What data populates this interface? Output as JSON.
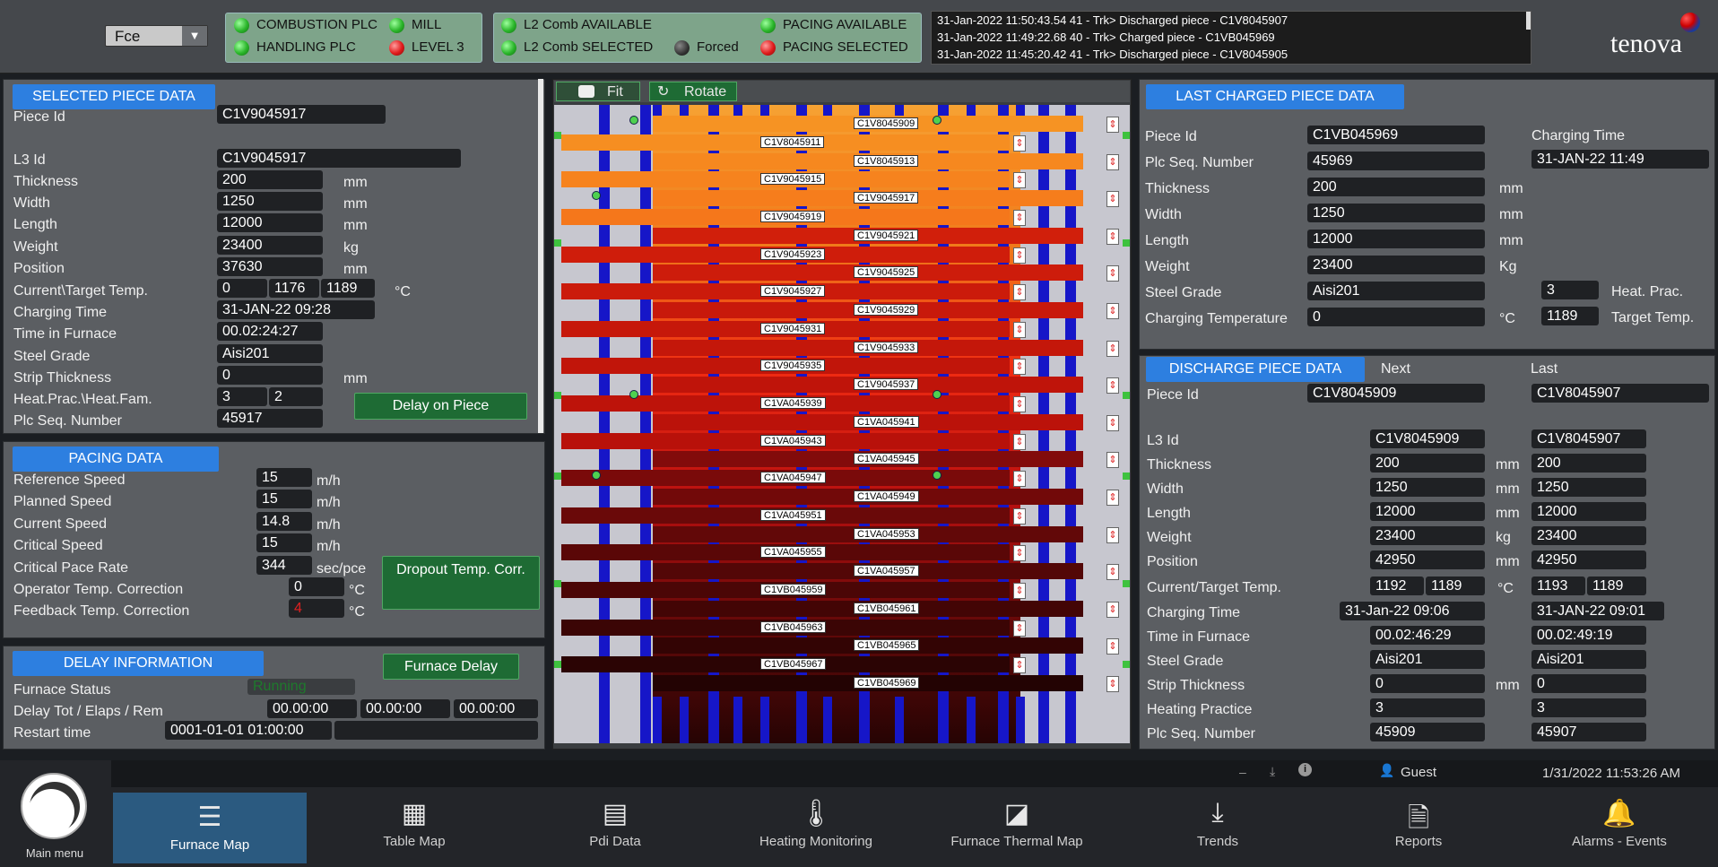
{
  "top": {
    "furnace_select": "Fce",
    "plc": [
      {
        "label": "COMBUSTION PLC",
        "state": "green"
      },
      {
        "label": "MILL",
        "state": "green"
      },
      {
        "label": "HANDLING PLC",
        "state": "green"
      },
      {
        "label": "LEVEL 3",
        "state": "red"
      }
    ],
    "comb": [
      {
        "label": "L2 Comb AVAILABLE",
        "state": "green"
      },
      {
        "label": "PACING AVAILABLE",
        "state": "green"
      },
      {
        "label": "L2 Comb SELECTED",
        "state": "green"
      },
      {
        "label": "Forced",
        "state": "black"
      },
      {
        "label": "PACING SELECTED",
        "state": "red"
      }
    ],
    "log": [
      "31-Jan-2022 11:50:43.54 41 - Trk> Discharged piece - C1V8045907",
      "31-Jan-2022 11:49:22.68 40 - Trk> Charged piece - C1VB045969",
      "31-Jan-2022 11:45:20.42 41 - Trk> Discharged piece - C1V8045905"
    ],
    "brand": "tenova"
  },
  "selected": {
    "title": "SELECTED PIECE DATA",
    "piece_id_label": "Piece Id",
    "piece_id": "C1V9045917",
    "rows": [
      {
        "label": "L3 Id",
        "value": "C1V9045917",
        "unit": ""
      },
      {
        "label": "Thickness",
        "value": "200",
        "unit": "mm"
      },
      {
        "label": "Width",
        "value": "1250",
        "unit": "mm"
      },
      {
        "label": "Length",
        "value": "12000",
        "unit": "mm"
      },
      {
        "label": "Weight",
        "value": "23400",
        "unit": "kg"
      },
      {
        "label": "Position",
        "value": "37630",
        "unit": "mm"
      }
    ],
    "temp_label": "Current\\Target Temp.",
    "temp_cur": "0",
    "temp_a": "1176",
    "temp_b": "1189",
    "temp_unit": "°C",
    "charging_time_label": "Charging Time",
    "charging_time": "31-JAN-22 09:28",
    "time_furnace_label": "Time in Furnace",
    "time_furnace": "00.02:24:27",
    "steel_grade_label": "Steel Grade",
    "steel_grade": "Aisi201",
    "strip_label": "Strip Thickness",
    "strip": "0",
    "strip_unit": "mm",
    "heat_label": "Heat.Prac.\\Heat.Fam.",
    "heat_prac": "3",
    "heat_fam": "2",
    "plc_seq_label": "Plc Seq. Number",
    "plc_seq": "45917",
    "delay_button": "Delay on Piece"
  },
  "pacing": {
    "title": "PACING DATA",
    "rows": [
      {
        "label": "Reference Speed",
        "value": "15",
        "unit": "m/h"
      },
      {
        "label": "Planned Speed",
        "value": "15",
        "unit": "m/h"
      },
      {
        "label": "Current Speed",
        "value": "14.8",
        "unit": "m/h"
      },
      {
        "label": "Critical Speed",
        "value": "15",
        "unit": "m/h"
      },
      {
        "label": "Critical Pace Rate",
        "value": "344",
        "unit": "sec/pce"
      }
    ],
    "op_corr_label": "Operator Temp. Correction",
    "op_corr": "0",
    "op_unit": "°C",
    "fb_corr_label": "Feedback Temp. Correction",
    "fb_corr": "4",
    "fb_unit": "°C",
    "dropout_button": "Dropout Temp. Corr."
  },
  "delay": {
    "title": "DELAY INFORMATION",
    "button": "Furnace Delay",
    "status_label": "Furnace Status",
    "status": "Running",
    "tot_label": "Delay Tot / Elaps / Rem",
    "tot": "00.00:00",
    "elaps": "00.00:00",
    "rem": "00.00:00",
    "restart_label": "Restart time",
    "restart": "0001-01-01 01:00:00"
  },
  "map": {
    "fit": "Fit",
    "rotate": "Rotate",
    "pieces_left": [
      "C1V8045911",
      "C1V9045915",
      "C1V9045919",
      "C1V9045923",
      "C1V9045927",
      "C1V9045931",
      "C1V9045935",
      "C1VA045939",
      "C1VA045943",
      "C1VA045947",
      "C1VA045951",
      "C1VA045955",
      "C1VB045959",
      "C1VB045963",
      "C1VB045967"
    ],
    "pieces_right": [
      "C1V8045909",
      "C1V8045913",
      "C1V9045917",
      "C1V9045921",
      "C1V9045925",
      "C1V9045929",
      "C1V9045933",
      "C1V9045937",
      "C1VA045941",
      "C1VA045945",
      "C1VA045949",
      "C1VA045953",
      "C1VA045957",
      "C1VB045961",
      "C1VB045965",
      "C1VB045969"
    ]
  },
  "last_charged": {
    "title": "LAST CHARGED PIECE DATA",
    "rows": [
      {
        "label": "Piece Id",
        "value": "C1VB045969",
        "unit": ""
      },
      {
        "label": "Plc Seq. Number",
        "value": "45969",
        "unit": ""
      },
      {
        "label": "Thickness",
        "value": "200",
        "unit": "mm"
      },
      {
        "label": "Width",
        "value": "1250",
        "unit": "mm"
      },
      {
        "label": "Length",
        "value": "12000",
        "unit": "mm"
      },
      {
        "label": "Weight",
        "value": "23400",
        "unit": "Kg"
      },
      {
        "label": "Steel Grade",
        "value": "Aisi201",
        "unit": ""
      },
      {
        "label": "Charging Temperature",
        "value": "0",
        "unit": "°C"
      }
    ],
    "charging_time_label": "Charging Time",
    "charging_time": "31-JAN-22 11:49",
    "heat_prac": "3",
    "heat_prac_label": "Heat. Prac.",
    "target": "1189",
    "target_label": "Target Temp."
  },
  "discharge": {
    "title": "DISCHARGE PIECE DATA",
    "next": "Next",
    "last": "Last",
    "piece_id_label": "Piece Id",
    "next_id": "C1V8045909",
    "last_id": "C1V8045907",
    "rows": [
      {
        "label": "L3 Id",
        "next": "C1V8045909",
        "last": "C1V8045907",
        "unit": ""
      },
      {
        "label": "Thickness",
        "next": "200",
        "last": "200",
        "unit": "mm"
      },
      {
        "label": "Width",
        "next": "1250",
        "last": "1250",
        "unit": "mm"
      },
      {
        "label": "Length",
        "next": "12000",
        "last": "12000",
        "unit": "mm"
      },
      {
        "label": "Weight",
        "next": "23400",
        "last": "23400",
        "unit": "kg"
      },
      {
        "label": "Position",
        "next": "42950",
        "last": "42950",
        "unit": "mm"
      }
    ],
    "temp_label": "Current/Target Temp.",
    "next_cur": "1192",
    "next_tgt": "1189",
    "temp_unit": "°C",
    "last_cur": "1193",
    "last_tgt": "1189",
    "rows2": [
      {
        "label": "Charging Time",
        "next": "31-Jan-22 09:06",
        "last": "31-JAN-22 09:01",
        "unit": ""
      },
      {
        "label": "Time in Furnace",
        "next": "00.02:46:29",
        "last": "00.02:49:19",
        "unit": ""
      },
      {
        "label": "Steel Grade",
        "next": "Aisi201",
        "last": "Aisi201",
        "unit": ""
      },
      {
        "label": "Strip Thickness",
        "next": "0",
        "last": "0",
        "unit": "mm"
      },
      {
        "label": "Heating Practice",
        "next": "3",
        "last": "3",
        "unit": ""
      },
      {
        "label": "Plc Seq. Number",
        "next": "45909",
        "last": "45907",
        "unit": ""
      }
    ]
  },
  "status_bar": {
    "user": "Guest",
    "datetime": "1/31/2022 11:53:26 AM"
  },
  "nav": {
    "main_menu": "Main menu",
    "items": [
      {
        "label": "Furnace Map",
        "icon": "furnace-map-icon",
        "active": true
      },
      {
        "label": "Table Map",
        "icon": "table-map-icon",
        "active": false
      },
      {
        "label": "Pdi Data",
        "icon": "pdi-data-icon",
        "active": false
      },
      {
        "label": "Heating Monitoring",
        "icon": "heating-monitoring-icon",
        "active": false
      },
      {
        "label": "Furnace Thermal Map",
        "icon": "thermal-map-icon",
        "active": false
      },
      {
        "label": "Trends",
        "icon": "trends-icon",
        "active": false
      },
      {
        "label": "Reports",
        "icon": "reports-icon",
        "active": false
      },
      {
        "label": "Alarms - Events",
        "icon": "alarms-icon",
        "active": false
      }
    ]
  }
}
